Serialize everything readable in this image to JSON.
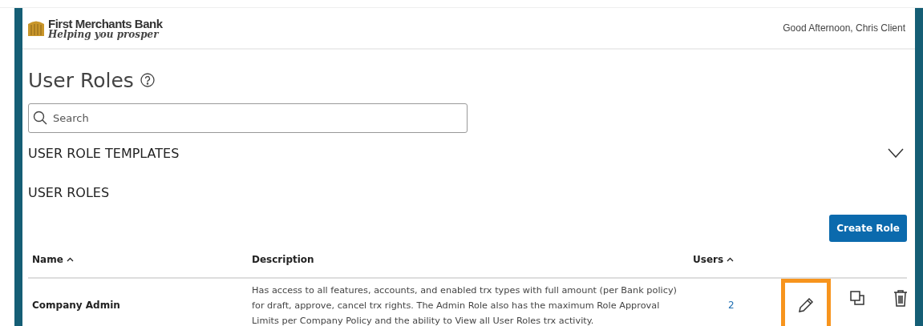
{
  "header": {
    "bank_name": "First Merchants Bank",
    "tagline": "Helping you prosper",
    "greeting": "Good Afternoon, Chris Client"
  },
  "page": {
    "title": "User Roles",
    "search": {
      "placeholder": "Search"
    }
  },
  "sections": [
    {
      "title": "USER ROLE TEMPLATES",
      "expanded": false
    },
    {
      "title": "USER ROLES"
    }
  ],
  "create_button": "Create Role",
  "table": {
    "columns": [
      {
        "label": "Name",
        "sorted_ascending": true
      },
      {
        "label": "Description"
      },
      {
        "label": "Users",
        "sorted_ascending": true
      }
    ],
    "rows": [
      {
        "name": "Company Admin",
        "description": "Has access to all features, accounts, and enabled trx types with full amount (per Bank policy) for draft, approve, cancel trx rights. The Admin Role also has the maximum Role Approval Limits per Company Policy and the ability to View all User Roles trx activity.",
        "users": "2",
        "actions": [
          {
            "kind": "edit",
            "highlighted": true
          },
          {
            "kind": "copy",
            "highlighted": false
          },
          {
            "kind": "delete",
            "highlighted": false
          }
        ]
      }
    ]
  }
}
